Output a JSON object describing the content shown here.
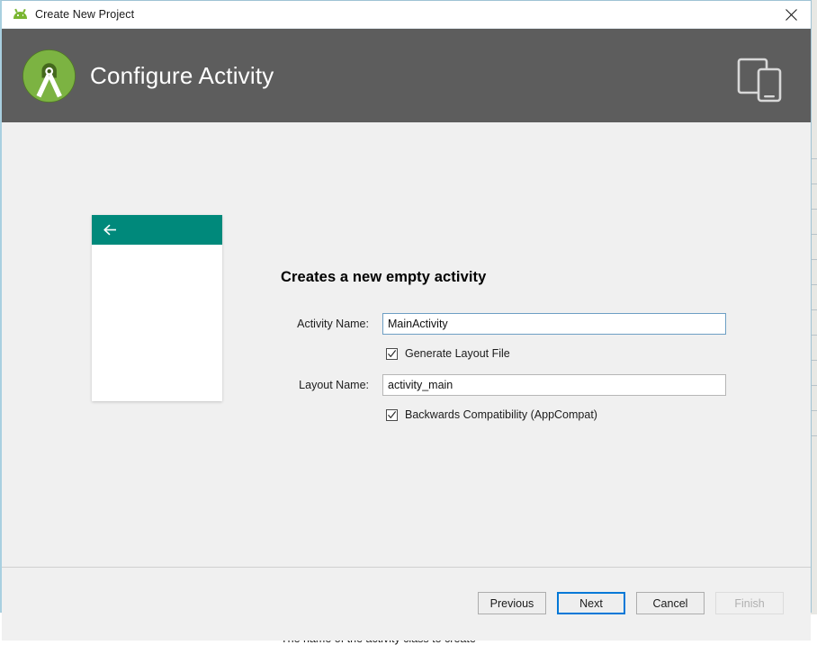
{
  "window": {
    "title": "Create New Project",
    "title_icon": "android-robot-icon",
    "close_label": "×"
  },
  "header": {
    "title": "Configure Activity",
    "logo": "android-studio-logo",
    "device_icon": "tablet-and-phone-icon"
  },
  "preview": {
    "name": "activity-preview-thumbnail",
    "app_bar_color": "#00897B",
    "back_icon": "back-arrow-icon"
  },
  "form": {
    "heading": "Creates a new empty activity",
    "fields": [
      {
        "label": "Activity Name:",
        "value": "MainActivity",
        "focused": true
      },
      {
        "label": "Layout Name:",
        "value": "activity_main",
        "focused": false
      }
    ],
    "checkboxes": [
      {
        "label": "Generate Layout File",
        "checked": true
      },
      {
        "label": "Backwards Compatibility (AppCompat)",
        "checked": true
      }
    ],
    "help_text": "The name of the activity class to create"
  },
  "footer": {
    "buttons": [
      {
        "label": "Previous",
        "state": "enabled"
      },
      {
        "label": "Next",
        "state": "focused"
      },
      {
        "label": "Cancel",
        "state": "enabled"
      },
      {
        "label": "Finish",
        "state": "disabled"
      }
    ]
  },
  "colors": {
    "header_background": "#5D5D5D",
    "body_background": "#F0F0F0",
    "accent_teal": "#00897B",
    "logo_green": "#7CB342",
    "focus_blue": "#0078D7"
  }
}
